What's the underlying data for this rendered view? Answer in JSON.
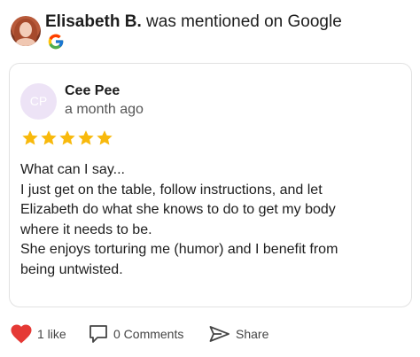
{
  "header": {
    "person_name": "Elisabeth B.",
    "mention_text": " was mentioned on Google",
    "source_icon": "google-icon"
  },
  "review": {
    "reviewer_initials": "CP",
    "reviewer_name": "Cee Pee",
    "time_ago": "a month ago",
    "rating": 5,
    "rating_max": 5,
    "star_color": "#f8b90c",
    "lines": [
      "What can I say...",
      "I just get on the table, follow instructions, and let",
      "Elizabeth do what she knows to do to get my body",
      "where it needs to be.",
      "She enjoys torturing me (humor) and I benefit from",
      "being untwisted."
    ]
  },
  "actions": {
    "like_label": "1 like",
    "like_icon": "heart-icon",
    "like_color": "#e53935",
    "comments_label": "0 Comments",
    "comments_icon": "comment-icon",
    "share_label": "Share",
    "share_icon": "share-icon"
  }
}
